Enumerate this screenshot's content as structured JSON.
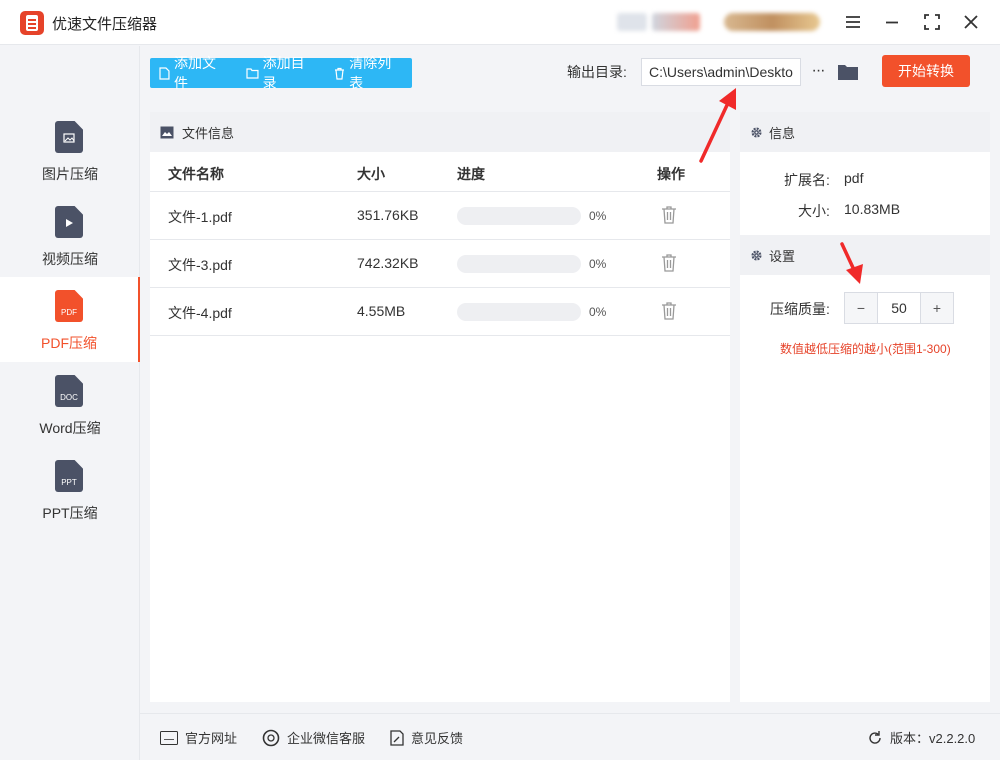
{
  "app": {
    "title": "优速文件压缩器"
  },
  "sidebar": {
    "items": [
      {
        "label": "图片压缩",
        "badge": ""
      },
      {
        "label": "视频压缩",
        "badge": ""
      },
      {
        "label": "PDF压缩",
        "badge": "PDF"
      },
      {
        "label": "Word压缩",
        "badge": "DOC"
      },
      {
        "label": "PPT压缩",
        "badge": "PPT"
      }
    ]
  },
  "toolbar": {
    "add_file": "添加文件",
    "add_dir": "添加目录",
    "clear_list": "清除列表"
  },
  "output": {
    "label": "输出目录:",
    "path": "C:\\Users\\admin\\Deskto",
    "more": "···",
    "start": "开始转换"
  },
  "file_panel": {
    "title": "文件信息",
    "columns": [
      "文件名称",
      "大小",
      "进度",
      "操作"
    ],
    "rows": [
      {
        "name": "文件-1.pdf",
        "size": "351.76KB",
        "progress": 0,
        "progress_text": "0%"
      },
      {
        "name": "文件-3.pdf",
        "size": "742.32KB",
        "progress": 0,
        "progress_text": "0%"
      },
      {
        "name": "文件-4.pdf",
        "size": "4.55MB",
        "progress": 0,
        "progress_text": "0%"
      }
    ]
  },
  "info": {
    "title": "信息",
    "ext_label": "扩展名:",
    "ext_value": "pdf",
    "size_label": "大小:",
    "size_value": "10.83MB"
  },
  "settings": {
    "title": "设置",
    "quality_label": "压缩质量:",
    "quality_value": "50",
    "minus": "−",
    "plus": "+",
    "hint": "数值越低压缩的越小(范围1-300)"
  },
  "footer": {
    "website": "官方网址",
    "wechat": "企业微信客服",
    "feedback": "意见反馈",
    "version": "版本：v2.2.2.0"
  },
  "colors": {
    "accent": "#f2512b",
    "toolbar": "#2db7f5"
  }
}
